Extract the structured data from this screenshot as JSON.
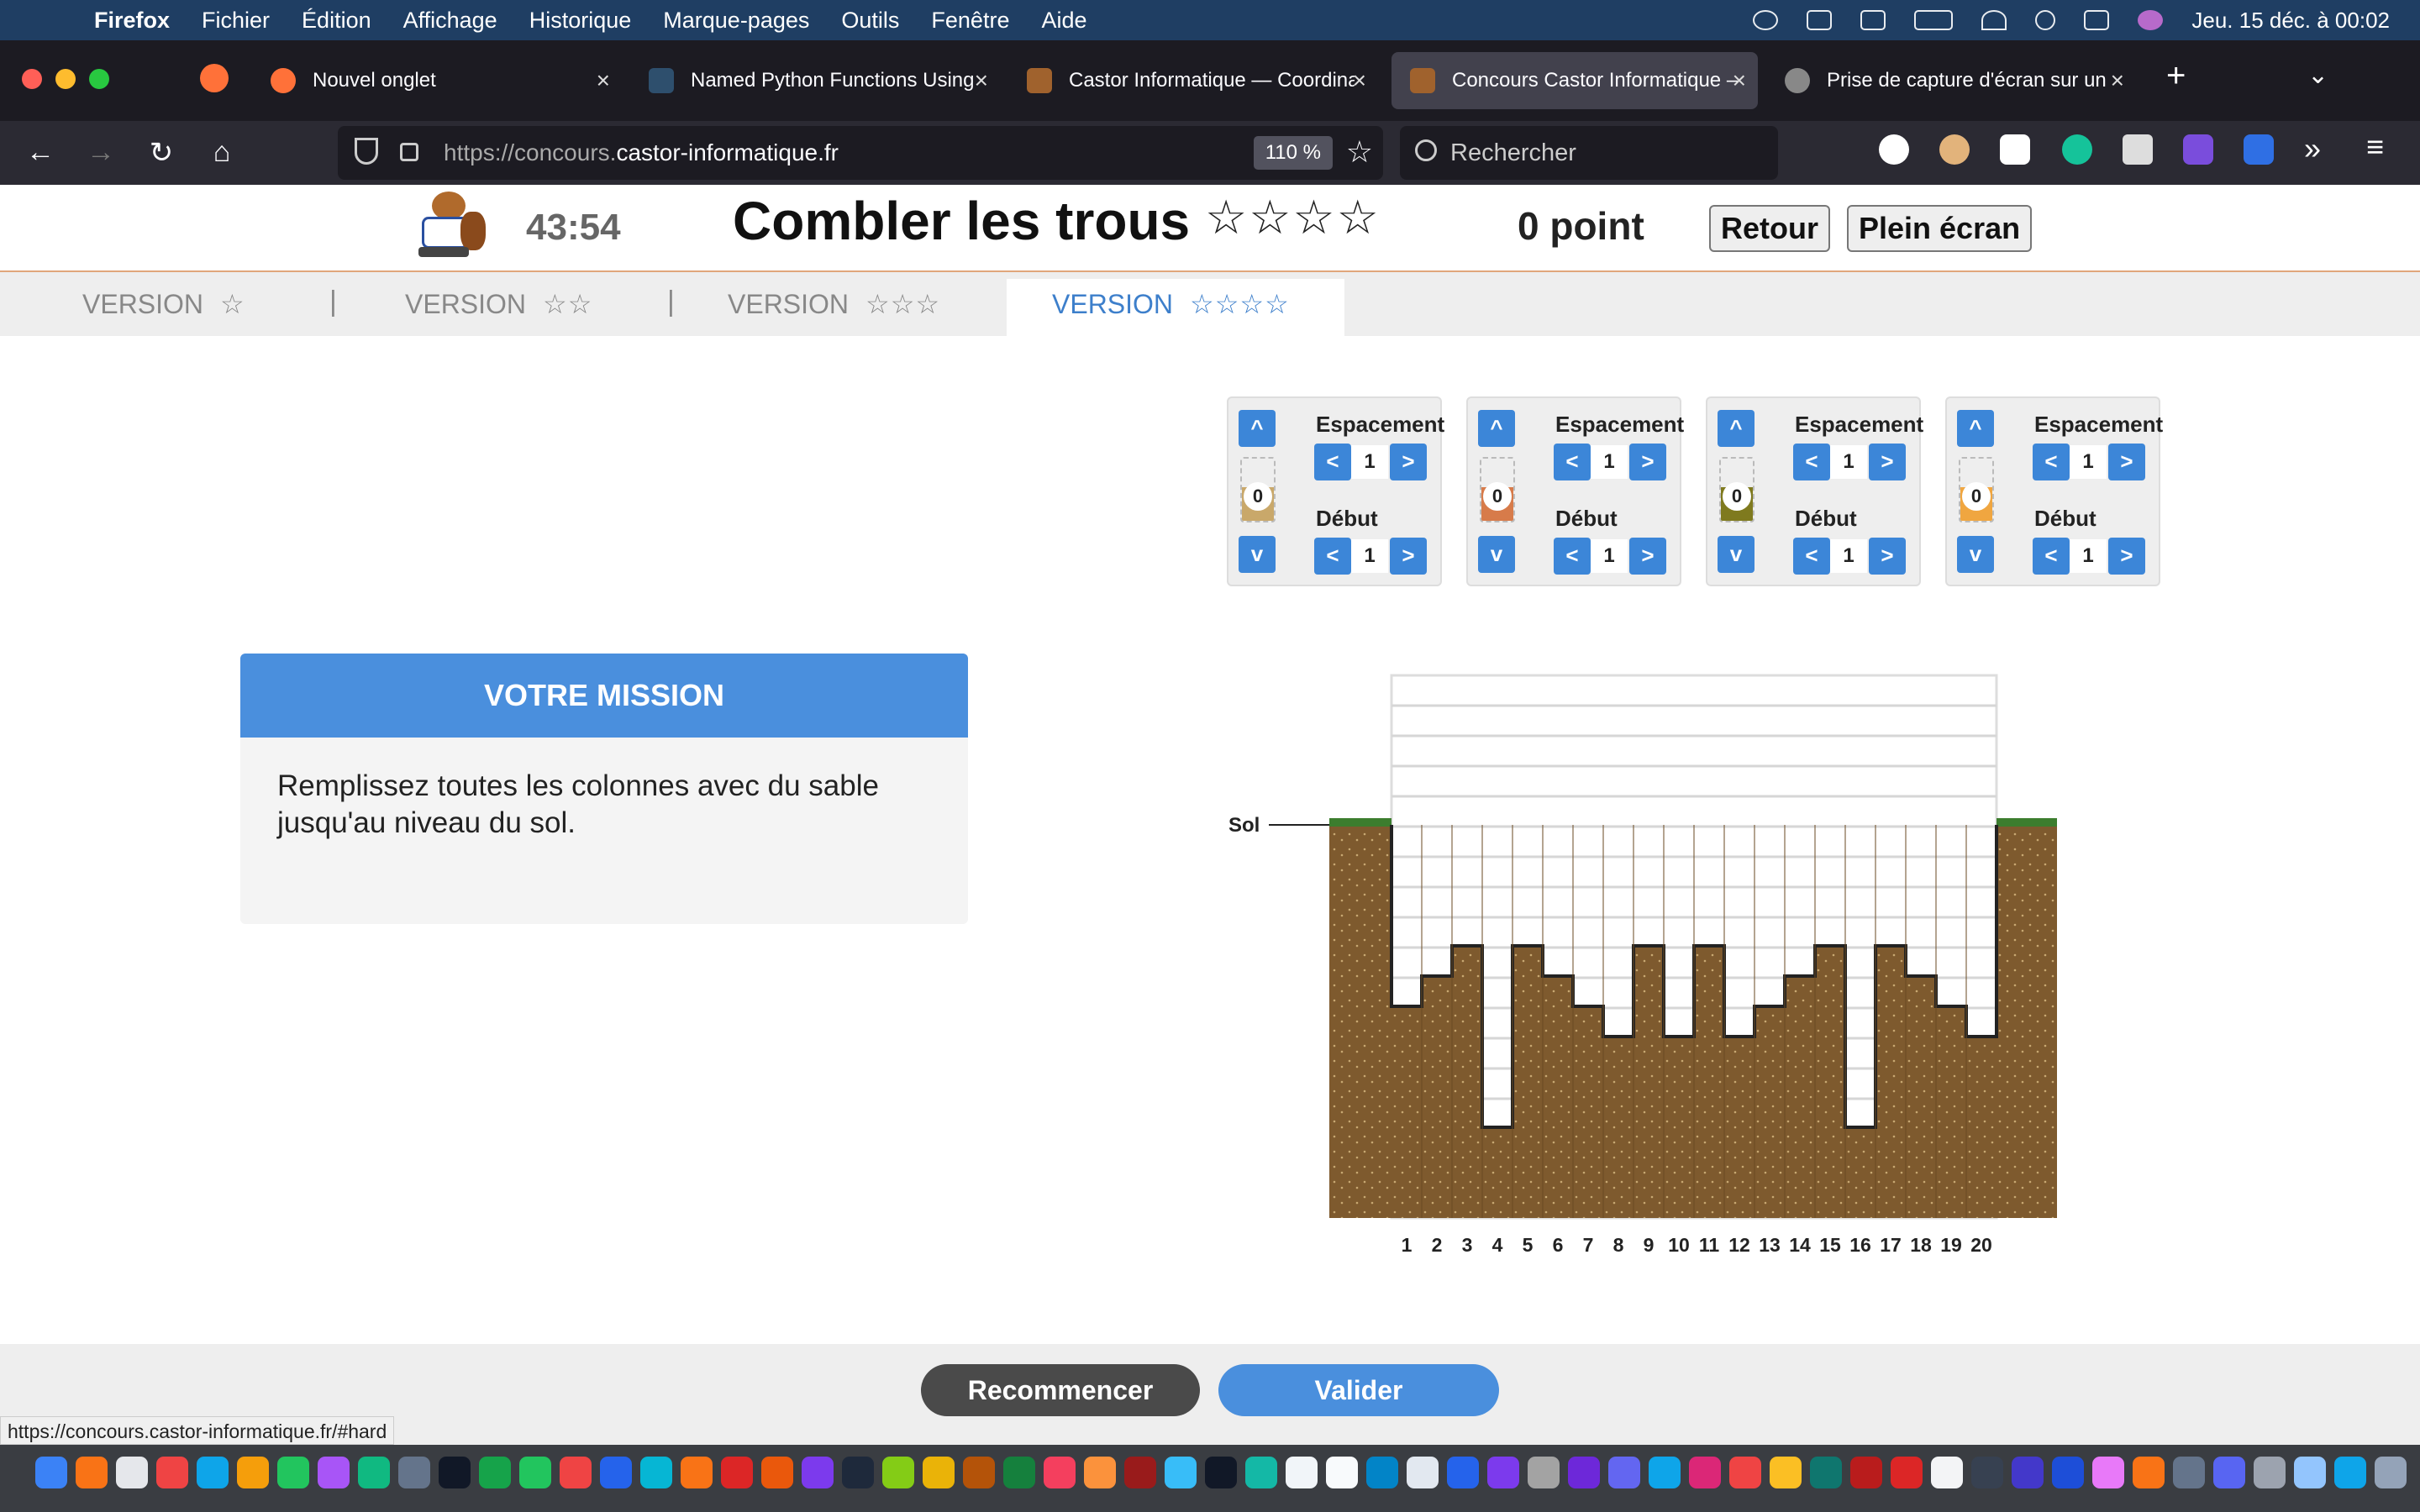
{
  "menubar": {
    "app": "Firefox",
    "items": [
      "Fichier",
      "Édition",
      "Affichage",
      "Historique",
      "Marque-pages",
      "Outils",
      "Fenêtre",
      "Aide"
    ],
    "datetime": "Jeu. 15 déc. à  00:02"
  },
  "tabs": [
    {
      "title": "Nouvel onglet",
      "color": "#ff7139"
    },
    {
      "title": "Named Python Functions Using",
      "color": "#2e4f6d"
    },
    {
      "title": "Castor Informatique — Coordina",
      "color": "#a0622d"
    },
    {
      "title": "Concours Castor Informatique —",
      "color": "#a0622d"
    },
    {
      "title": "Prise de capture d'écran sur un",
      "color": "#888888"
    }
  ],
  "url": {
    "prefix": "https://concours.",
    "domain": "castor-informatique.fr",
    "zoom": "110 %"
  },
  "search": {
    "placeholder": "Rechercher"
  },
  "header": {
    "timer": "43:54",
    "title": "Combler les trous",
    "stars": "☆☆☆☆",
    "points": "0 point",
    "back": "Retour",
    "fullscreen": "Plein écran"
  },
  "versions": [
    {
      "label": "VERSION",
      "stars": "☆"
    },
    {
      "label": "VERSION",
      "stars": "☆☆"
    },
    {
      "label": "VERSION",
      "stars": "☆☆☆"
    },
    {
      "label": "VERSION",
      "stars": "☆☆☆☆"
    }
  ],
  "version_separator": "|",
  "dumpers": [
    {
      "count": "0",
      "spacing_label": "Espacement",
      "spacing": "1",
      "start_label": "Début",
      "start": "1",
      "color": "#c9a86a"
    },
    {
      "count": "0",
      "spacing_label": "Espacement",
      "spacing": "1",
      "start_label": "Début",
      "start": "1",
      "color": "#d77b4a"
    },
    {
      "count": "0",
      "spacing_label": "Espacement",
      "spacing": "1",
      "start_label": "Début",
      "start": "1",
      "color": "#7f7a1e"
    },
    {
      "count": "0",
      "spacing_label": "Espacement",
      "spacing": "1",
      "start_label": "Début",
      "start": "1",
      "color": "#f0a640"
    }
  ],
  "buttons": {
    "up": "^",
    "down": "v",
    "dec": "<",
    "inc": ">"
  },
  "mission": {
    "heading": "VOTRE MISSION",
    "text": "Remplissez toutes les colonnes avec du sable jusqu'au niveau du sol."
  },
  "terrain": {
    "ground_label": "Sol",
    "depths": [
      6,
      5,
      4,
      10,
      4,
      5,
      6,
      7,
      4,
      7,
      4,
      7,
      6,
      5,
      4,
      10,
      4,
      5,
      6,
      7
    ],
    "column_labels": [
      "1",
      "2",
      "3",
      "4",
      "5",
      "6",
      "7",
      "8",
      "9",
      "10",
      "11",
      "12",
      "13",
      "14",
      "15",
      "16",
      "17",
      "18",
      "19",
      "20"
    ]
  },
  "footer": {
    "restart": "Recommencer",
    "validate": "Valider"
  },
  "status_url": "https://concours.castor-informatique.fr/#hard"
}
